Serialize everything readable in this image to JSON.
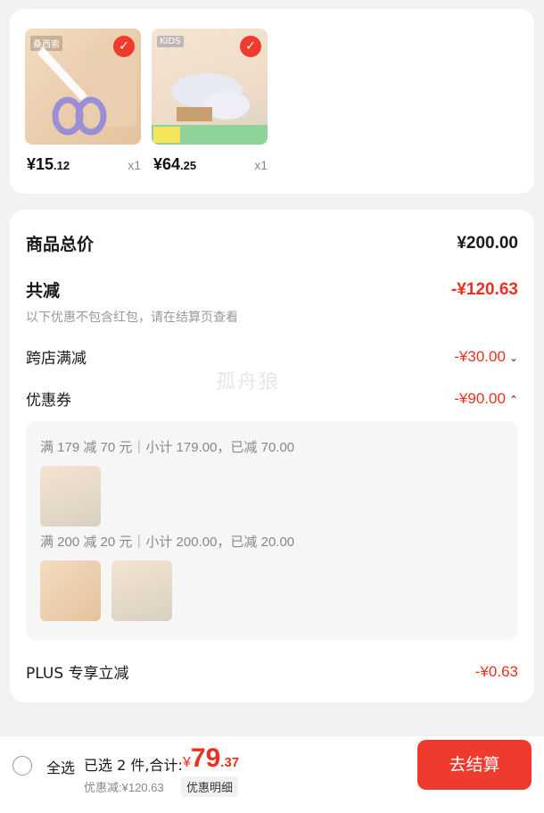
{
  "products": [
    {
      "brand_tag": "桑西索",
      "price_int": "¥15",
      "price_dec": ".12",
      "qty": "x1",
      "check_icon": "check-icon"
    },
    {
      "brand_tag": "KIDS",
      "price_int": "¥64",
      "price_dec": ".25",
      "qty": "x1",
      "check_icon": "check-icon"
    }
  ],
  "summary": {
    "total_label": "商品总价",
    "total_value": "¥200.00",
    "reduce_label": "共减",
    "reduce_value": "-¥120.63",
    "reduce_note": "以下优惠不包含红包，请在结算页查看",
    "cross_store_label": "跨店满减",
    "cross_store_value": "-¥30.00",
    "cross_store_chevron": "⌄",
    "coupon_label": "优惠券",
    "coupon_value": "-¥90.00",
    "coupon_chevron": "⌃",
    "plus_label": "PLUS 专享立减",
    "plus_value": "-¥0.63"
  },
  "coupon_details": [
    {
      "title": "满 179 减 70 元｜小计 179.00，已减 70.00"
    },
    {
      "title": "满 200 减 20 元｜小计 200.00，已减 20.00"
    }
  ],
  "watermark": "孤舟狼",
  "bottom": {
    "select_all": "全选",
    "selected_info": "已选 2 件,合计:",
    "currency": "¥",
    "total_int": "79",
    "total_dec": ".37",
    "discount_line": "优惠减:¥120.63",
    "detail_button": "优惠明细",
    "checkout_button": "去结算"
  },
  "colors": {
    "accent_red": "#ef3b2d",
    "price_red": "#e8321f",
    "background": "#f2f2f2"
  }
}
